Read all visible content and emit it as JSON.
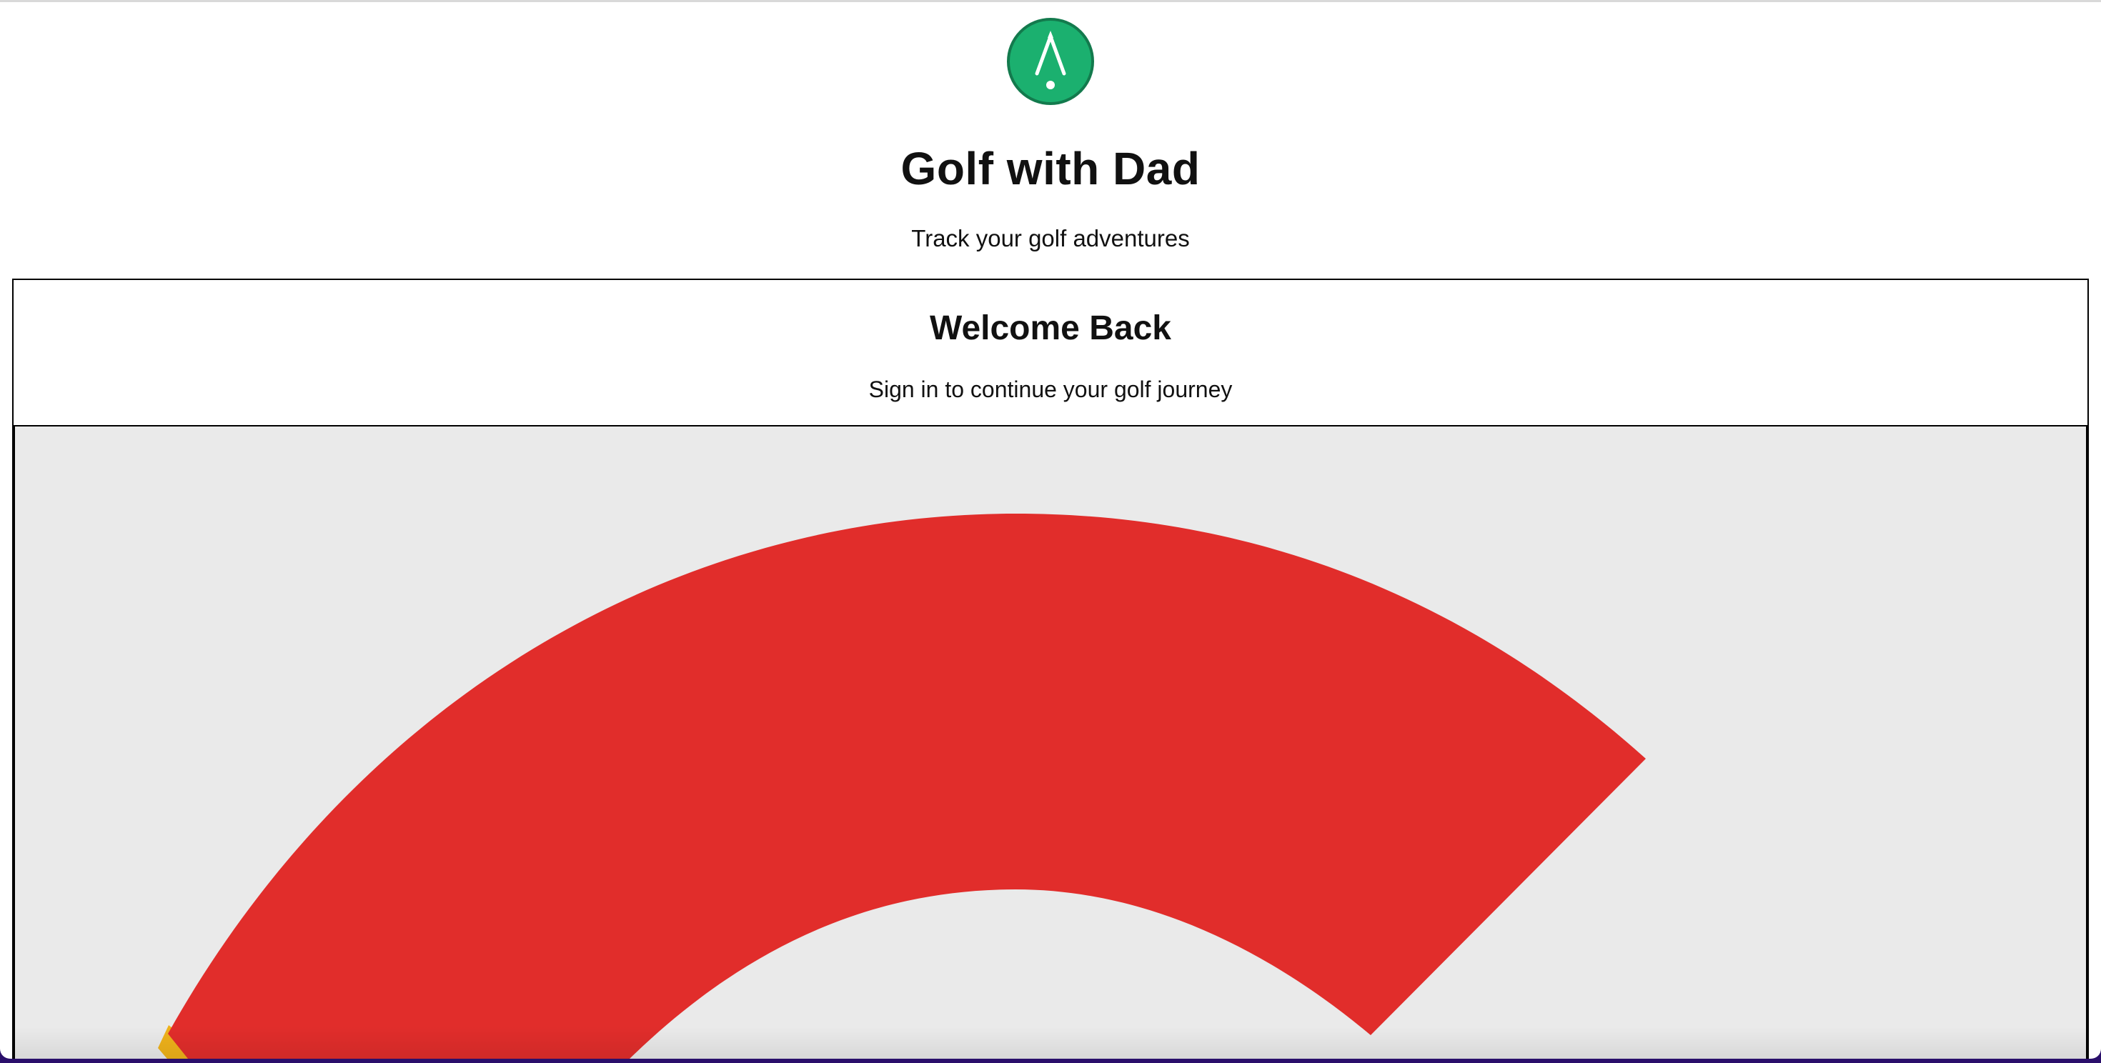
{
  "app": {
    "title": "Golf with Dad",
    "subtitle": "Track your golf adventures",
    "logo_icon": "golf-club-icon"
  },
  "login_card": {
    "title": "Welcome Back",
    "subtitle": "Sign in to continue your golf journey"
  },
  "google_button": {
    "icon": "google-logo-icon"
  },
  "colors": {
    "brand_green": "#1bb06f",
    "brand_green_dark": "#137a4d",
    "google_red": "#e12d2b",
    "google_yellow": "#efb21a",
    "panel_gray": "#eaeaea",
    "outer_background": "#2a0f6b"
  }
}
